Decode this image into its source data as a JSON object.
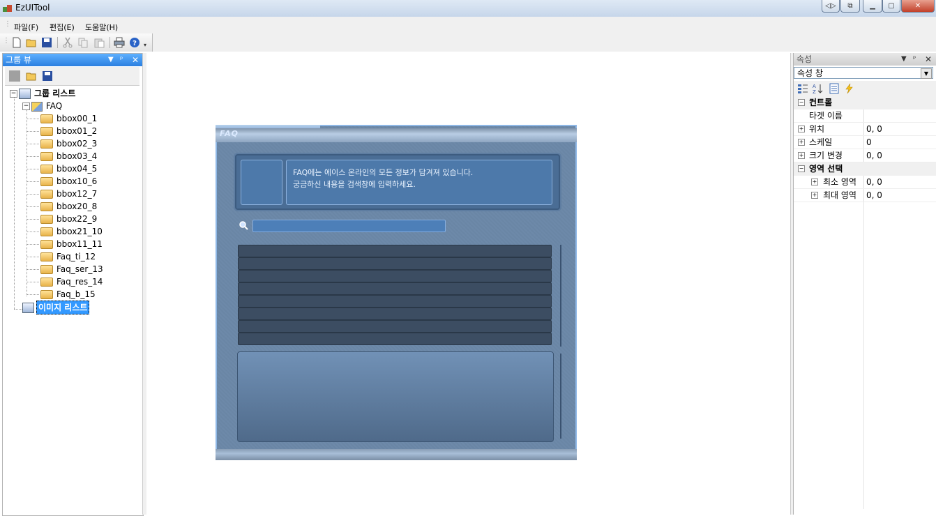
{
  "window": {
    "title": "EzUITool"
  },
  "menu": {
    "file": "파일(F)",
    "edit": "편집(E)",
    "help": "도움말(H)"
  },
  "group_panel": {
    "title": "그룹 뷰",
    "tree": {
      "root": "그룹 리스트",
      "faq": "FAQ",
      "items": [
        "bbox00_1",
        "bbox01_2",
        "bbox02_3",
        "bbox03_4",
        "bbox04_5",
        "bbox10_6",
        "bbox12_7",
        "bbox20_8",
        "bbox22_9",
        "bbox21_10",
        "bbox11_11",
        "Faq_ti_12",
        "Faq_ser_13",
        "Faq_res_14",
        "Faq_b_15"
      ],
      "image_list": "이미지 리스트"
    }
  },
  "faq_window": {
    "title": "FAQ",
    "message_line1": "FAQ에는 에이스 온라인의 모든 정보가 담겨져 있습니다.",
    "message_line2": "궁금하신 내용을 검색창에 입력하세요.",
    "list_row_count": 8
  },
  "property_panel": {
    "title": "속성",
    "combo_value": "속성 창",
    "categories": {
      "control": "컨트롤",
      "region": "영역 선택"
    },
    "rows": {
      "target_name": {
        "name": "타겟 이름",
        "value": ""
      },
      "position": {
        "name": "위치",
        "value": "0, 0"
      },
      "scale": {
        "name": "스케일",
        "value": "0"
      },
      "resize": {
        "name": "크기 변경",
        "value": "0, 0"
      },
      "min_region": {
        "name": "최소 영역",
        "value": "0, 0"
      },
      "max_region": {
        "name": "최대 영역",
        "value": "0, 0"
      }
    }
  },
  "colors": {
    "active_pane": "#2b7fe0",
    "selection": "#3399ff"
  }
}
